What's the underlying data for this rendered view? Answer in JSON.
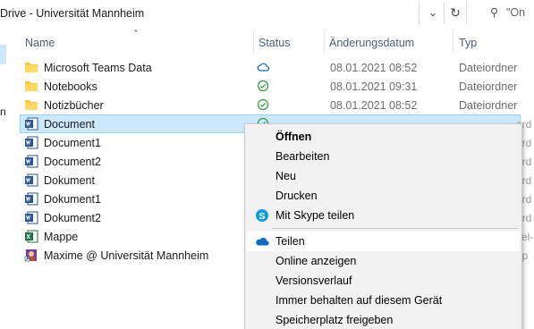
{
  "address": {
    "path": "Drive - Universität Mannheim",
    "search_placeholder": "\"On"
  },
  "nav": {
    "partial_letter": "n"
  },
  "columns": {
    "name": "Name",
    "status": "Status",
    "date": "Änderungsdatum",
    "type": "Typ"
  },
  "files": [
    {
      "name": "Microsoft Teams Data",
      "icon": "folder-icon",
      "status": "cloud-icon",
      "date": "08.01.2021 08:52",
      "type": "Dateiordner"
    },
    {
      "name": "Notebooks",
      "icon": "folder-icon",
      "status": "check-icon",
      "date": "08.01.2021 09:31",
      "type": "Dateiordner"
    },
    {
      "name": "Notizbücher",
      "icon": "folder-icon",
      "status": "check-icon",
      "date": "08.01.2021 08:52",
      "type": "Dateiordner"
    },
    {
      "name": "Document",
      "icon": "word-icon",
      "status": "check-icon",
      "date": "",
      "type": "",
      "type_cut": "ord"
    },
    {
      "name": "Document1",
      "icon": "word-icon",
      "status": "",
      "date": "",
      "type": "",
      "type_cut": "ord"
    },
    {
      "name": "Document2",
      "icon": "word-icon",
      "status": "",
      "date": "",
      "type": "",
      "type_cut": "ord"
    },
    {
      "name": "Dokument",
      "icon": "word-icon",
      "status": "",
      "date": "",
      "type": "",
      "type_cut": "ord"
    },
    {
      "name": "Dokument1",
      "icon": "word-icon",
      "status": "",
      "date": "",
      "type": "",
      "type_cut": "ord"
    },
    {
      "name": "Dokument2",
      "icon": "word-icon",
      "status": "",
      "date": "",
      "type": "",
      "type_cut": "ord"
    },
    {
      "name": "Mappe",
      "icon": "excel-icon",
      "status": "",
      "date": "",
      "type": "",
      "type_cut": "cel-"
    },
    {
      "name": "Maxime @ Universität Mannheim",
      "icon": "shortcut-icon",
      "status": "",
      "date": "",
      "type": "",
      "type_cut": "üp"
    }
  ],
  "context_menu": {
    "items": [
      {
        "label": "Öffnen",
        "bold": true
      },
      {
        "label": "Bearbeiten"
      },
      {
        "label": "Neu"
      },
      {
        "label": "Drucken"
      },
      {
        "label": "Mit Skype teilen",
        "icon": "skype-icon"
      },
      {
        "label": "Teilen",
        "icon": "onedrive-cloud-icon"
      },
      {
        "label": "Online anzeigen"
      },
      {
        "label": "Versionsverlauf"
      },
      {
        "label": "Immer behalten auf diesem Gerät"
      },
      {
        "label": "Speicherplatz freigeben"
      }
    ]
  },
  "colors": {
    "selection": "#cce8ff",
    "folder": "#ffc83d",
    "word": "#2b579a",
    "excel": "#1e7145",
    "sync_green": "#2e9e47",
    "cloud_blue": "#0f6cbd"
  }
}
